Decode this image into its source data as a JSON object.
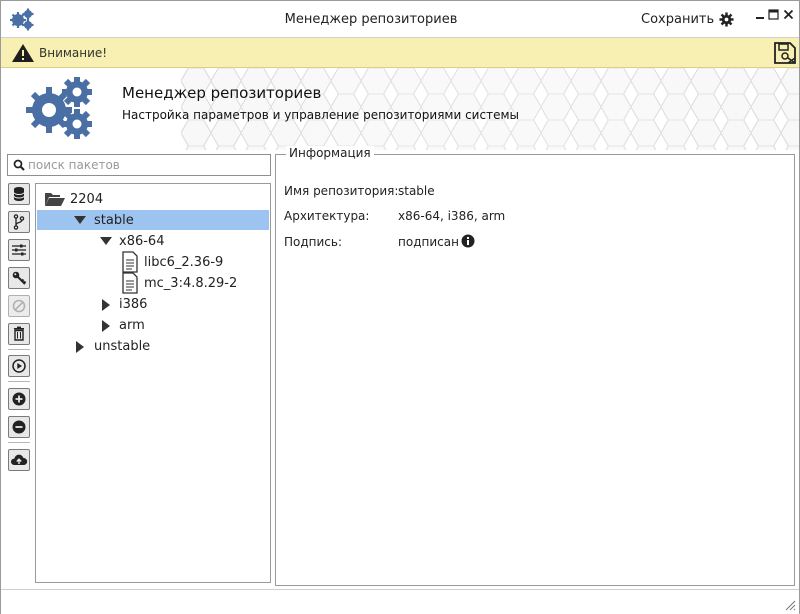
{
  "window": {
    "title": "Менеджер репозиториев",
    "save_label": "Сохранить"
  },
  "banner": {
    "text": "Внимание!"
  },
  "header": {
    "title": "Менеджер репозиториев",
    "subtitle": "Настройка параметров и управление репозиториями системы"
  },
  "search": {
    "placeholder": "поиск пакетов"
  },
  "tree": {
    "root": "2204",
    "stable": "stable",
    "arch_x86": "x86-64",
    "pkg1": "libc6_2.36-9",
    "pkg2": "mc_3:4.8.29-2",
    "arch_i386": "i386",
    "arch_arm": "arm",
    "unstable": "unstable"
  },
  "info": {
    "legend": "Информация",
    "rows": [
      {
        "label": "Имя репозитория:",
        "value": "stable"
      },
      {
        "label": "Архитектура:",
        "value": "x86-64, i386, arm"
      },
      {
        "label": "Подпись:",
        "value": "подписан"
      }
    ]
  },
  "colors": {
    "accent_blue": "#4a6fa5",
    "banner_bg": "#f7f0b2",
    "selection": "#9dc3f0"
  },
  "icons": [
    "gears-icon",
    "gear-icon",
    "minimize-icon",
    "maximize-icon",
    "close-icon",
    "warning-icon",
    "save-disk-icon",
    "search-icon",
    "database-icon",
    "branch-icon",
    "sliders-icon",
    "key-icon",
    "disabled-icon",
    "trash-icon",
    "play-icon",
    "add-icon",
    "remove-icon",
    "cloud-upload-icon",
    "folder-open-icon",
    "file-icon",
    "info-icon",
    "resize-grip-icon"
  ]
}
